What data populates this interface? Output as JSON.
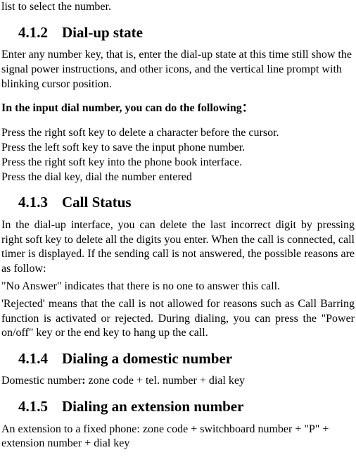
{
  "fragment_top": "list to select the number.",
  "sections": {
    "s412": {
      "num": "4.1.2",
      "title": "Dial-up state",
      "intro": "Enter any number key, that is, enter the dial-up state at this time still show the signal power instructions, and other icons, and the vertical line prompt with blinking cursor position.",
      "bold_lead": "In the input dial number, you can do the following：",
      "items": [
        "Press the right soft key to delete a character before the cursor.",
        "Press the left soft key to save the input phone number.",
        "Press the right soft key into the phone book interface.",
        "Press the dial key, dial the number entered"
      ]
    },
    "s413": {
      "num": "4.1.3",
      "title": "Call Status",
      "para1": "In the dial-up interface, you can delete the last incorrect digit by pressing right soft key to delete all the digits you enter. When the call is connected, call timer is displayed. If the sending call is not answered, the possible reasons are as follow:",
      "para2": "\"No Answer\" indicates that there is no one to answer this call.",
      "para3": "'Rejected' means that the call is not allowed for reasons such as Call Barring function is activated or rejected. During dialing, you can press the \"Power on/off\" key or the end key to hang up the call."
    },
    "s414": {
      "num": "4.1.4",
      "title": "Dialing a domestic number",
      "line_prefix": "Domestic number",
      "line_bold_colon": ":",
      "line_rest": " zone code + tel. number + dial key"
    },
    "s415": {
      "num": "4.1.5",
      "title": "Dialing an extension number",
      "line": "An extension to a fixed phone: zone code + switchboard number + \"P\" + extension number + dial key"
    }
  }
}
